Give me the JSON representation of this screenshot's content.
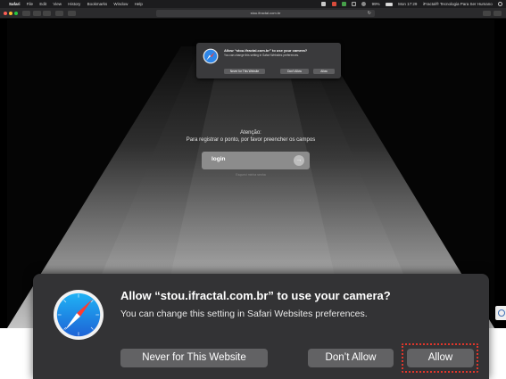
{
  "menubar": {
    "apple_icon": "apple-logo-icon",
    "app_name": "Safari",
    "menus": [
      "File",
      "Edit",
      "View",
      "History",
      "Bookmarks",
      "Window",
      "Help"
    ],
    "battery": "99%",
    "clock": "Mon 17:29",
    "profile": "iFractal® Tecnologia Para Ser Humano"
  },
  "browser": {
    "url": "stou.ifractal.com.br"
  },
  "mini_prompt": {
    "title": "Allow “stou.ifractal.com.br” to use your camera?",
    "message": "You can change this setting in Safari Websites preferences.",
    "never_label": "Never for This Website",
    "dont_allow_label": "Don’t Allow",
    "allow_label": "Allow"
  },
  "webpage": {
    "attention": "Atenção:",
    "instruction": "Para registrar o ponto, por favor preencher os campos",
    "login_label": "login",
    "forgot_label": "Esqueci minha senha"
  },
  "prompt": {
    "title": "Allow “stou.ifractal.com.br” to use your camera?",
    "message": "You can change this setting in Safari Websites preferences.",
    "never_label": "Never for This Website",
    "dont_allow_label": "Don’t Allow",
    "allow_label": "Allow"
  },
  "colors": {
    "prompt_bg": "#333335",
    "button_bg": "#626264",
    "highlight": "#e0362b",
    "safari_blue": "#2e86e8"
  }
}
